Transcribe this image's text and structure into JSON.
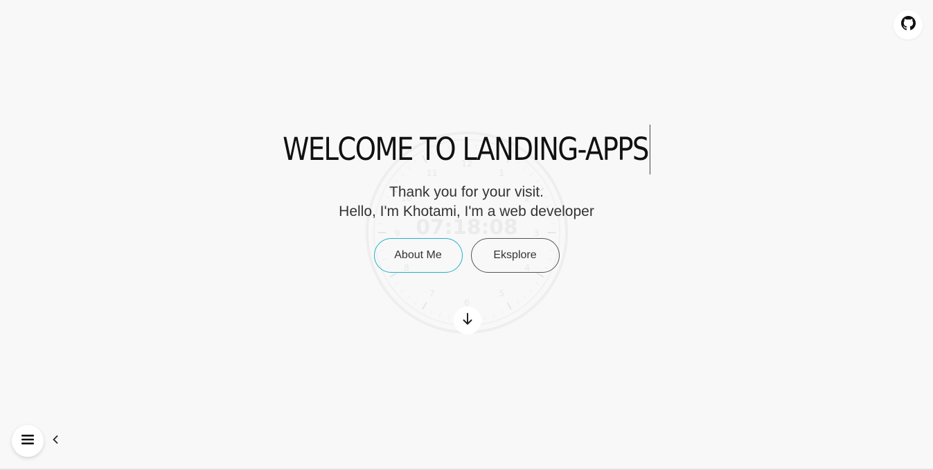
{
  "header": {
    "github_icon": "github-icon"
  },
  "clock": {
    "time": "07:18:08",
    "numerals": [
      "1",
      "2",
      "3",
      "4",
      "5",
      "6",
      "7",
      "8",
      "9",
      "10",
      "11",
      "12"
    ]
  },
  "hero": {
    "title": "WELCOME TO LANDING-APPS",
    "subtitle_line1": "Thank you for your visit.",
    "subtitle_line2": "Hello, I'm Khotami, I'm a web developer"
  },
  "actions": {
    "about_label": "About Me",
    "explore_label": "Eksplore"
  },
  "icons": {
    "scroll": "arrow-down-icon",
    "menu": "hamburger-menu-icon",
    "collapse": "chevron-left-icon"
  },
  "colors": {
    "background": "#f8f8f8",
    "accent": "#1fb3c9",
    "text": "#222222"
  }
}
